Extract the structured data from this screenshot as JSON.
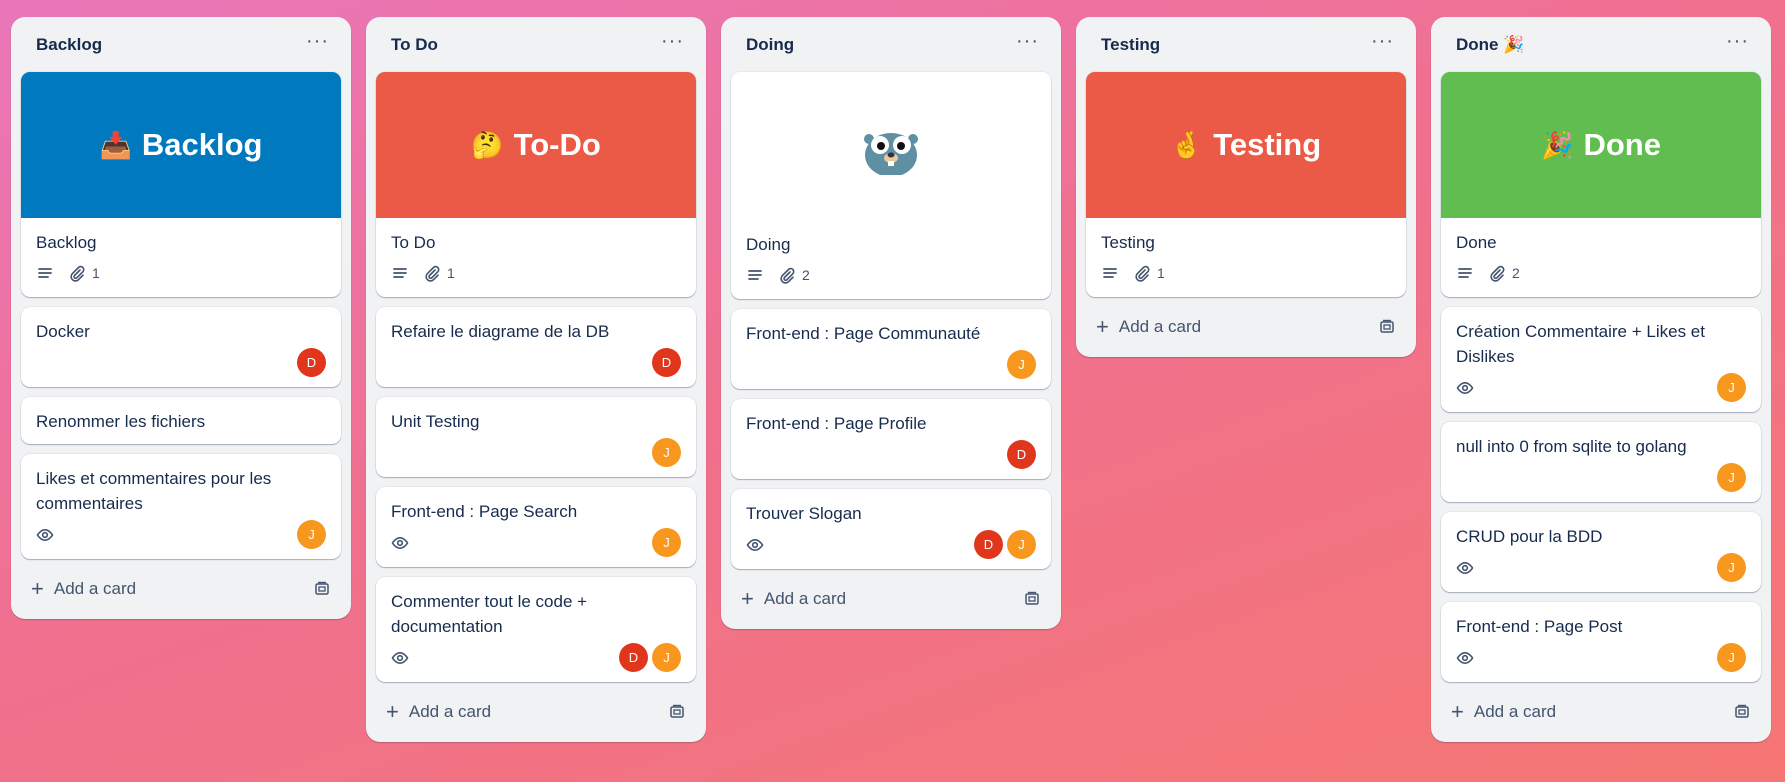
{
  "colors": {
    "backlog_cover": "#0079bf",
    "todo_cover": "#eb5a46",
    "testing_cover": "#eb5a46",
    "done_cover": "#61bd4f",
    "avatar_d": "#e0361b",
    "avatar_j": "#f7971e"
  },
  "lists": [
    {
      "title": "Backlog",
      "menu": "···",
      "cover": {
        "emoji": "📥",
        "text": "Backlog"
      },
      "cards": [
        {
          "title": "Backlog",
          "attachments": "1"
        },
        {
          "title": "Docker",
          "avatars": [
            "D"
          ]
        },
        {
          "title": "Renommer les fichiers"
        },
        {
          "title": "Likes et commentaires pour les commentaires",
          "avatars": [
            "J"
          ]
        }
      ],
      "add_label": "Add a card"
    },
    {
      "title": "To Do",
      "menu": "···",
      "cover": {
        "emoji": "🤔",
        "text": "To-Do"
      },
      "cards": [
        {
          "title": "To Do",
          "attachments": "1"
        },
        {
          "title": "Refaire le diagrame de la DB",
          "avatars": [
            "D"
          ]
        },
        {
          "title": "Unit Testing",
          "avatars": [
            "J"
          ]
        },
        {
          "title": "Front-end : Page Search",
          "avatars": [
            "J"
          ]
        },
        {
          "title": "Commenter tout le code + documentation",
          "avatars": [
            "D",
            "J"
          ]
        }
      ],
      "add_label": "Add a card"
    },
    {
      "title": "Doing",
      "menu": "···",
      "cover": {
        "emoji": "🐹"
      },
      "cards": [
        {
          "title": "Doing",
          "attachments": "2"
        },
        {
          "title": "Front-end : Page Communauté",
          "avatars": [
            "J"
          ]
        },
        {
          "title": "Front-end : Page Profile",
          "avatars": [
            "D"
          ]
        },
        {
          "title": "Trouver Slogan",
          "avatars": [
            "D",
            "J"
          ]
        }
      ],
      "add_label": "Add a card"
    },
    {
      "title": "Testing",
      "menu": "···",
      "cover": {
        "emoji": "🤞",
        "text": "Testing"
      },
      "cards": [
        {
          "title": "Testing",
          "attachments": "1"
        }
      ],
      "add_label": "Add a card"
    },
    {
      "title": "Done 🎉",
      "menu": "···",
      "cover": {
        "emoji": "🎉",
        "text": "Done"
      },
      "cards": [
        {
          "title": "Done",
          "attachments": "2"
        },
        {
          "title": "Création Commentaire + Likes et Dislikes",
          "avatars": [
            "J"
          ]
        },
        {
          "title": "null into 0 from sqlite to golang",
          "avatars": [
            "J"
          ]
        },
        {
          "title": "CRUD pour la BDD",
          "avatars": [
            "J"
          ]
        },
        {
          "title": "Front-end : Page Post",
          "avatars": [
            "J"
          ]
        }
      ],
      "add_label": "Add a card"
    }
  ]
}
